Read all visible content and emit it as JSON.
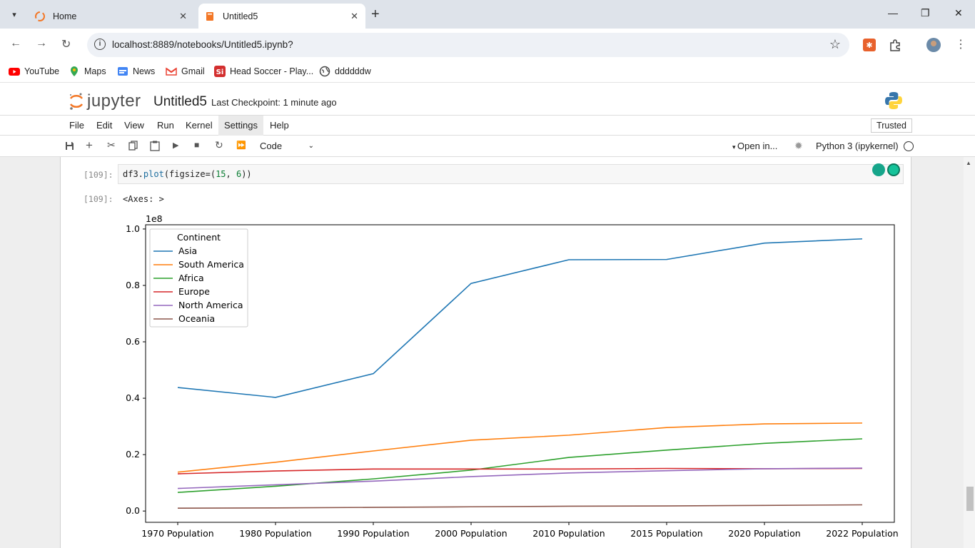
{
  "browser": {
    "tabs": [
      {
        "label": "Home"
      },
      {
        "label": "Untitled5"
      }
    ],
    "url": "localhost:8889/notebooks/Untitled5.ipynb?",
    "bookmarks": [
      {
        "label": "YouTube",
        "icon": "youtube-icon",
        "color": "#ff0000"
      },
      {
        "label": "Maps",
        "icon": "maps-icon",
        "color": "#34a853"
      },
      {
        "label": "News",
        "icon": "news-icon",
        "color": "#4285f4"
      },
      {
        "label": "Gmail",
        "icon": "gmail-icon",
        "color": "#ea4335"
      },
      {
        "label": "Head Soccer - Play...",
        "icon": "head-soccer-icon",
        "color": "#d32f2f"
      },
      {
        "label": "ddddddw",
        "icon": "globe-icon",
        "color": "#444444"
      }
    ]
  },
  "jupyter": {
    "logo_text": "jupyter",
    "notebook_title": "Untitled5",
    "checkpoint": "Last Checkpoint: 1 minute ago",
    "menu": [
      "File",
      "Edit",
      "View",
      "Run",
      "Kernel",
      "Settings",
      "Help"
    ],
    "active_menu": "Settings",
    "trusted": "Trusted",
    "cell_type": "Code",
    "open_in": "Open in...",
    "kernel": "Python 3 (ipykernel)"
  },
  "cell": {
    "in_prompt": "[109]:",
    "code": "df3.plot(figsize=(15, 6))",
    "out_prompt": "[109]:",
    "output_text": "<Axes: >"
  },
  "chart_data": {
    "type": "line",
    "categories": [
      "1970 Population",
      "1980 Population",
      "1990 Population",
      "2000 Population",
      "2010 Population",
      "2015 Population",
      "2020 Population",
      "2022 Population"
    ],
    "y_offset_label": "1e8",
    "ylim": [
      -0.04,
      1.015
    ],
    "yticks": [
      0.0,
      0.2,
      0.4,
      0.6,
      0.8,
      1.0
    ],
    "ytick_labels": [
      "0.0",
      "0.2",
      "0.4",
      "0.6",
      "0.8",
      "1.0"
    ],
    "legend_title": "Continent",
    "legend_position": "upper-left",
    "grid": false,
    "series": [
      {
        "name": "Asia",
        "color": "#1f77b4",
        "values": [
          0.438,
          0.403,
          0.487,
          0.807,
          0.891,
          0.892,
          0.95,
          0.965
        ]
      },
      {
        "name": "South America",
        "color": "#ff7f0e",
        "values": [
          0.138,
          0.173,
          0.213,
          0.251,
          0.269,
          0.296,
          0.309,
          0.312
        ]
      },
      {
        "name": "Africa",
        "color": "#2ca02c",
        "values": [
          0.066,
          0.088,
          0.114,
          0.145,
          0.19,
          0.216,
          0.24,
          0.256
        ]
      },
      {
        "name": "Europe",
        "color": "#d62728",
        "values": [
          0.132,
          0.142,
          0.149,
          0.149,
          0.149,
          0.151,
          0.15,
          0.151
        ]
      },
      {
        "name": "North America",
        "color": "#9467bd",
        "values": [
          0.08,
          0.093,
          0.106,
          0.122,
          0.135,
          0.143,
          0.15,
          0.152
        ]
      },
      {
        "name": "Oceania",
        "color": "#8c564b",
        "values": [
          0.01,
          0.011,
          0.013,
          0.015,
          0.017,
          0.018,
          0.02,
          0.022
        ]
      }
    ]
  }
}
